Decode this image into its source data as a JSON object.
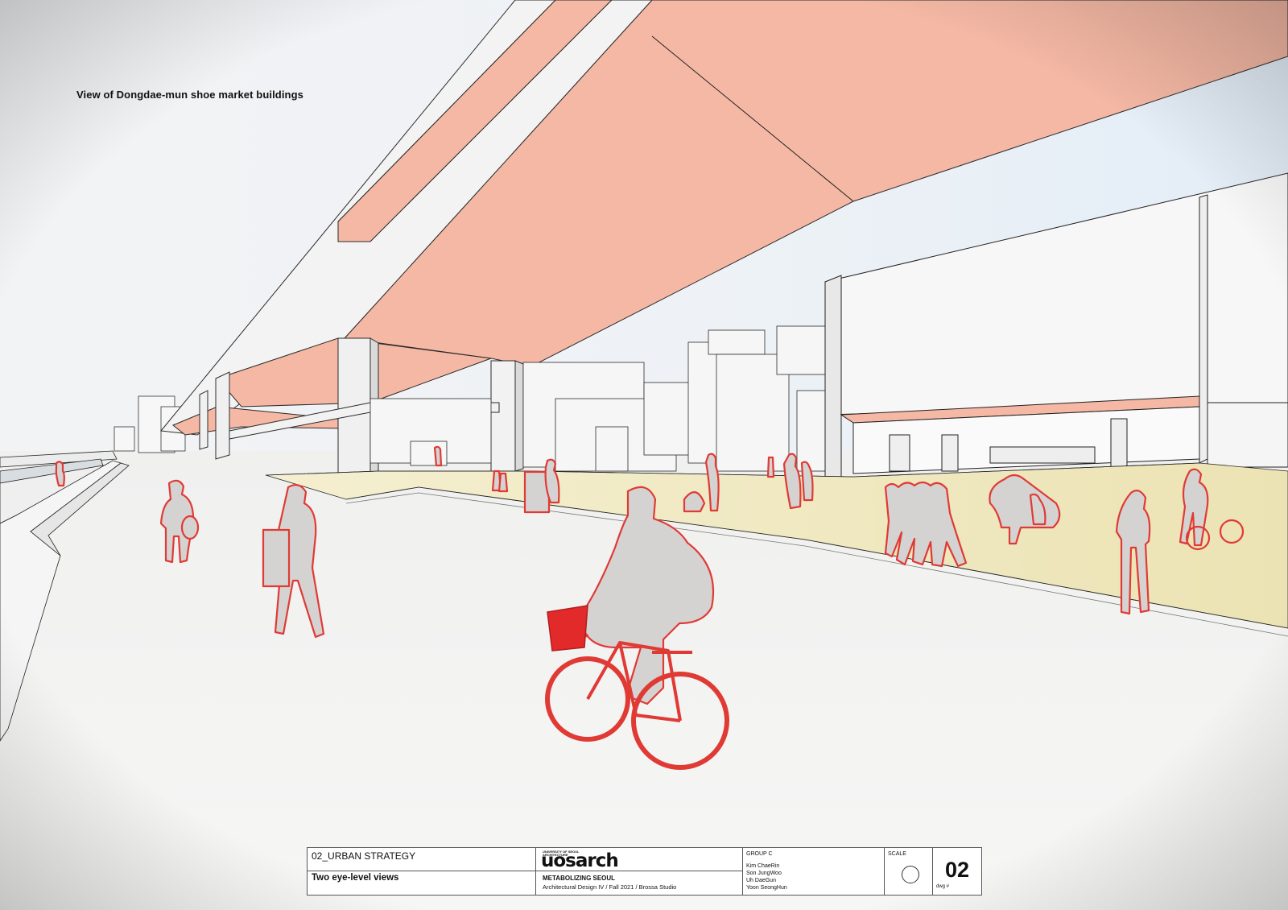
{
  "view_title": "View of Dongdae-mun shoe market buildings",
  "colors": {
    "paper": "#f2f2f0",
    "sky": "#e6eef6",
    "soffit": "#f4b8a4",
    "outline_red": "#e03a35",
    "figure_grey": "#d4d3d2",
    "sidewalk_yellow": "#f1ebc6",
    "basket_red": "#e32a2a"
  },
  "title_block": {
    "section": "02_URBAN STRATEGY",
    "heading": "Two eye-level views",
    "logo_small": "UNIVERSITY OF SEOUL ARCHITECTURE",
    "logo": "uosarch",
    "project": "METABOLIZING SEOUL",
    "course": "Architectural Design IV / Fall 2021 / Brossa Studio",
    "group": "GROUP C",
    "members": [
      "Kim ChaeRin",
      "Son JungWoo",
      "Uh DaeGun",
      "Yoon SeongHun"
    ],
    "scale_label": "SCALE",
    "dwg_number": "02",
    "dwg_label": "dwg #"
  }
}
